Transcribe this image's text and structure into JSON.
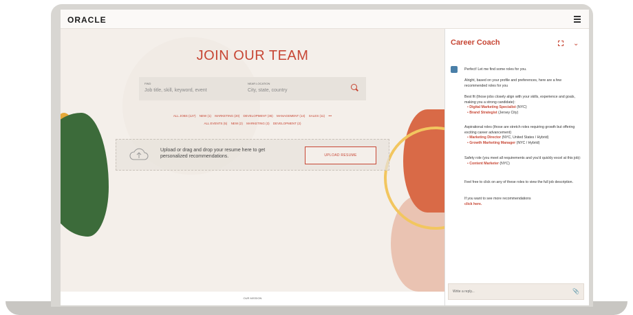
{
  "header": {
    "logo": "ORACLE"
  },
  "hero": {
    "title": "JOIN OUR TEAM",
    "search": {
      "find_label": "FIND",
      "find_placeholder": "Job title, skill, keyword, event",
      "near_label": "NEAR LOCATION",
      "near_placeholder": "City, state, country"
    },
    "filters_row1": [
      "ALL JOBS (127)",
      "NEW (1)",
      "MARKETING (20)",
      "DEVELOPMENT (36)",
      "MANAGEMENT (14)",
      "SALES (11)",
      "•••"
    ],
    "filters_row2": [
      "ALL EVENTS (5)",
      "NEW (2)",
      "MARKETING (3)",
      "DEVELOPMENT (2)"
    ],
    "upload": {
      "text": "Upload or drag and drop your resume here to get personalized recommendations.",
      "button": "UPLOAD RESUME"
    },
    "footer": "OUR MISSION"
  },
  "coach": {
    "title": "Career Coach",
    "intro": "Perfect! Let me find some roles for you.",
    "p1": "Alright, based on your profile and preferences, here are a few recommended roles for you",
    "best_fit_heading": "Best fit (those jobs closely align with your skills, experience and goals, making you a strong candidate):",
    "best_fit": [
      {
        "role": "Digital Marketing Specialist",
        "loc": "(NYC)"
      },
      {
        "role": "Brand Strategist",
        "loc": "(Jersey City)"
      }
    ],
    "aspirational_heading": "Aspirational roles (those are stretch roles requiring growth but offering exciting career advancement)",
    "aspirational": [
      {
        "role": "Marketing Director",
        "loc": "(NYC, United States / Hybrid)"
      },
      {
        "role": "Growth Marketing Manager",
        "loc": "(NYC / Hybrid)"
      }
    ],
    "safety_heading": "Safety role (you meet all requirements and you'd quickly excel at this job):",
    "safety": [
      {
        "role": "Content Marketer",
        "loc": "(NYC)"
      }
    ],
    "p_click": "Feel free to click on any of these roles to view the full job description.",
    "p_more": "If you want to see more recommendations",
    "more_link": "click here.",
    "reply_placeholder": "Write a reply..."
  }
}
